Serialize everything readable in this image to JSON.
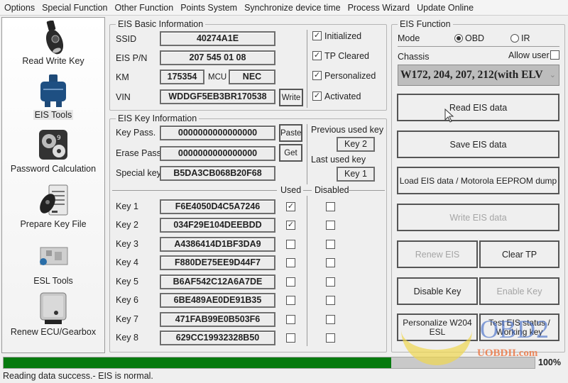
{
  "menu": [
    "Options",
    "Special Function",
    "Other Function",
    "Points System",
    "Synchronize device time",
    "Process Wizard",
    "Update Online"
  ],
  "sidebar": {
    "items": [
      {
        "label": "Read Write Key",
        "icon": "car-key-icon",
        "active": false
      },
      {
        "label": "EIS Tools",
        "icon": "eis-module-icon",
        "active": true
      },
      {
        "label": "Password Calculation",
        "icon": "gears-icon",
        "active": false
      },
      {
        "label": "Prepare Key File",
        "icon": "key-file-icon",
        "active": false
      },
      {
        "label": "ESL Tools",
        "icon": "esl-board-icon",
        "active": false
      },
      {
        "label": "Renew ECU/Gearbox",
        "icon": "ecu-icon",
        "active": false
      }
    ]
  },
  "basic_info": {
    "title": "EIS Basic Information",
    "ssid_label": "SSID",
    "ssid": "40274A1E",
    "pn_label": "EIS P/N",
    "pn": "207 545 01 08",
    "km_label": "KM",
    "km": "175354",
    "mcu_label": "MCU",
    "mcu": "NEC",
    "vin_label": "VIN",
    "vin": "WDDGF5EB3BR170538",
    "write_button": "Write",
    "flags": [
      {
        "label": "Initialized",
        "checked": true
      },
      {
        "label": "TP Cleared",
        "checked": true
      },
      {
        "label": "Personalized",
        "checked": true
      },
      {
        "label": "Activated",
        "checked": true
      }
    ]
  },
  "key_info": {
    "title": "EIS Key Information",
    "key_pass_label": "Key Pass.",
    "key_pass": "0000000000000000",
    "paste_button": "Paste",
    "erase_pass_label": "Erase Pass.",
    "erase_pass": "0000000000000000",
    "get_button": "Get",
    "special_key_label": "Special key",
    "special_key": "B5DA3CB068B20F68",
    "previous_used_label": "Previous used key",
    "previous_used": "Key 2",
    "last_used_label": "Last used key",
    "last_used": "Key 1",
    "used_header": "Used",
    "disabled_header": "Disabled",
    "keys": [
      {
        "label": "Key 1",
        "value": "F6E4050D4C5A7246",
        "used": true,
        "disabled": false
      },
      {
        "label": "Key 2",
        "value": "034F29E104DEEBDD",
        "used": true,
        "disabled": false
      },
      {
        "label": "Key 3",
        "value": "A4386414D1BF3DA9",
        "used": false,
        "disabled": false
      },
      {
        "label": "Key 4",
        "value": "F880DE75EE9D44F7",
        "used": false,
        "disabled": false
      },
      {
        "label": "Key 5",
        "value": "B6AF542C12A6A7DE",
        "used": false,
        "disabled": false
      },
      {
        "label": "Key 6",
        "value": "6BE489AE0DE91B35",
        "used": false,
        "disabled": false
      },
      {
        "label": "Key 7",
        "value": "471FAB99E0B503F6",
        "used": false,
        "disabled": false
      },
      {
        "label": "Key 8",
        "value": "629CC19932328B50",
        "used": false,
        "disabled": false
      }
    ]
  },
  "eis_function": {
    "title": "EIS Function",
    "mode_label": "Mode",
    "mode_options": [
      {
        "label": "OBD",
        "selected": true
      },
      {
        "label": "IR",
        "selected": false
      }
    ],
    "chassis_label": "Chassis",
    "allow_user_label": "Allow user",
    "allow_user_checked": false,
    "chassis_value": "W172, 204, 207, 212(with ELV",
    "buttons": {
      "read": "Read EIS data",
      "save": "Save EIS data",
      "load": "Load EIS data / Motorola EEPROM dump",
      "write": "Write EIS data",
      "renew": "Renew EIS",
      "clear_tp": "Clear TP",
      "disable_key": "Disable Key",
      "enable_key": "Enable Key",
      "personalize": "Personalize W204 ESL",
      "test_status": "Test EIS status / Working key"
    }
  },
  "progress": {
    "percent_text": "100%",
    "fill_fraction": 0.73
  },
  "status": "Reading data success.- EIS is normal.",
  "watermark": {
    "logo": "OBD2",
    "site": "UOBDII.com"
  },
  "colors": {
    "progress": "#067a0e",
    "disabled_text": "#a5a5a5"
  }
}
